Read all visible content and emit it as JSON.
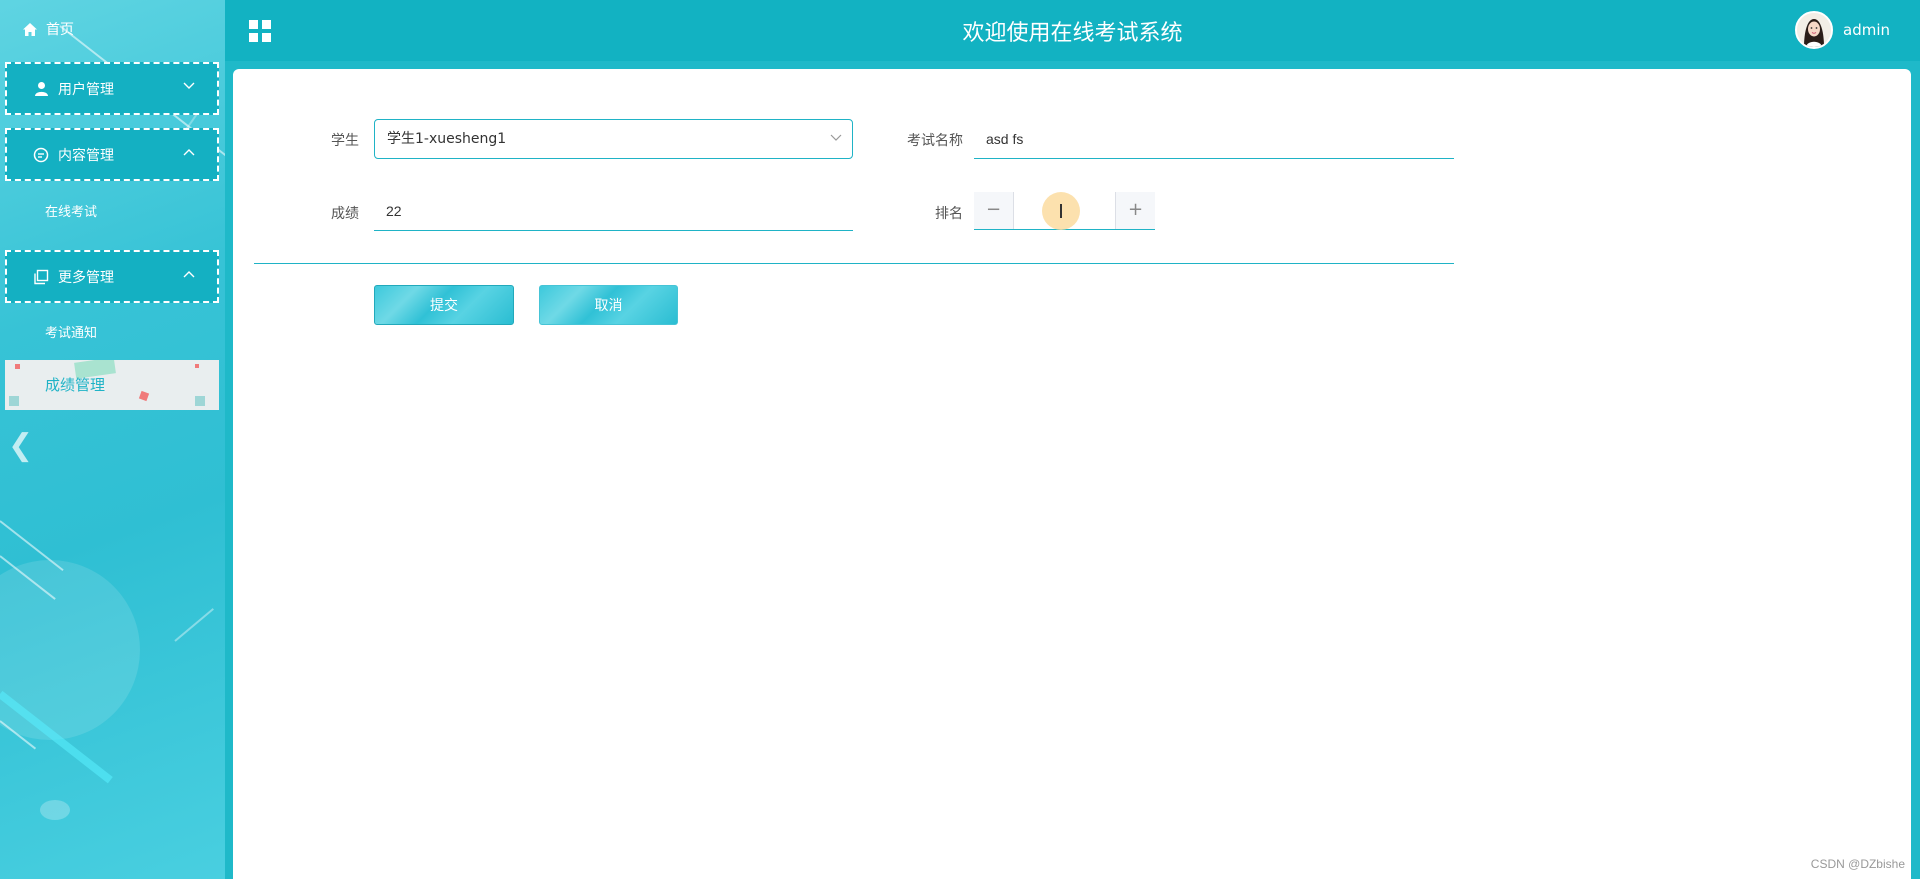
{
  "app": {
    "title": "欢迎使用在线考试系统"
  },
  "user": {
    "name": "admin"
  },
  "sidebar": {
    "home_label": "首页",
    "groups": [
      {
        "label": "用户管理",
        "icon": "user-icon",
        "expanded": false,
        "items": []
      },
      {
        "label": "内容管理",
        "icon": "chat-icon",
        "expanded": true,
        "items": [
          "在线考试"
        ]
      },
      {
        "label": "更多管理",
        "icon": "copy-icon",
        "expanded": true,
        "items": [
          "考试通知",
          "成绩管理"
        ]
      }
    ],
    "active_item": "成绩管理"
  },
  "form": {
    "student_label": "学生",
    "student_value": "学生1-xuesheng1",
    "exam_name_label": "考试名称",
    "exam_name_value": "asd fs",
    "score_label": "成绩",
    "score_value": "22",
    "rank_label": "排名",
    "rank_value": "",
    "submit_label": "提交",
    "cancel_label": "取消"
  },
  "colors": {
    "accent": "#12b2c2",
    "input_border": "#1fb3c6",
    "active_text": "#1fb3c6"
  },
  "watermark": "CSDN @DZbishe"
}
